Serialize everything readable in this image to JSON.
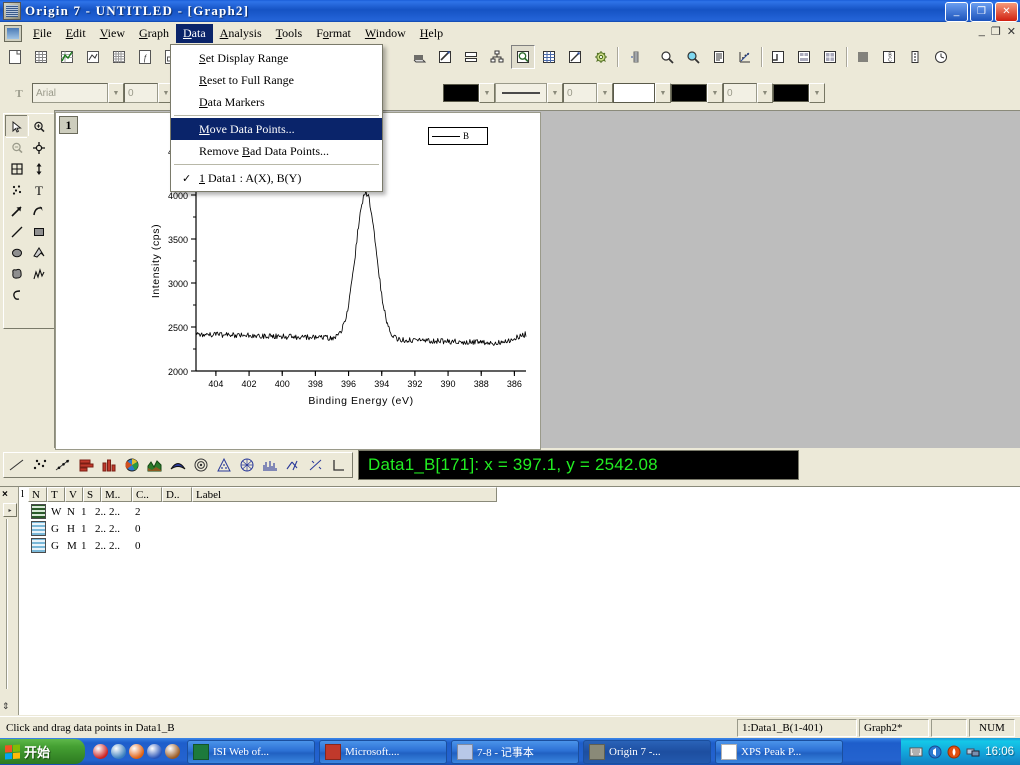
{
  "window": {
    "title": "Origin 7 - UNTITLED - [Graph2]",
    "minimize_label": "_",
    "maximize_label": "❐",
    "close_label": "✕",
    "mdi_minimize": "_",
    "mdi_restore": "❐",
    "mdi_close": "✕"
  },
  "menubar": {
    "items": [
      {
        "label": "File",
        "mnemonic": "F"
      },
      {
        "label": "Edit",
        "mnemonic": "E"
      },
      {
        "label": "View",
        "mnemonic": "V"
      },
      {
        "label": "Graph",
        "mnemonic": "G"
      },
      {
        "label": "Data",
        "mnemonic": "D"
      },
      {
        "label": "Analysis",
        "mnemonic": "A"
      },
      {
        "label": "Tools",
        "mnemonic": "T"
      },
      {
        "label": "Format",
        "mnemonic": "o"
      },
      {
        "label": "Window",
        "mnemonic": "W"
      },
      {
        "label": "Help",
        "mnemonic": "H"
      }
    ],
    "active_index": 4
  },
  "data_menu": {
    "items": [
      {
        "label": "Set Display Range",
        "mnemonic": "S",
        "selected": false,
        "checked": false
      },
      {
        "label": "Reset to Full Range",
        "mnemonic": "R",
        "selected": false,
        "checked": false
      },
      {
        "label": "Data Markers",
        "mnemonic": "D",
        "selected": false,
        "checked": false
      },
      {
        "separator": true
      },
      {
        "label": "Move Data Points...",
        "mnemonic": "M",
        "selected": true,
        "checked": false
      },
      {
        "label": "Remove Bad Data Points...",
        "mnemonic": "B",
        "selected": false,
        "checked": false
      },
      {
        "separator": true
      },
      {
        "label": "1     Data1 : A(X), B(Y)",
        "mnemonic": "1",
        "selected": false,
        "checked": true
      }
    ]
  },
  "standard_toolbar": {
    "buttons": [
      {
        "name": "new-project-icon",
        "glyph": "page"
      },
      {
        "name": "new-worksheet-icon",
        "glyph": "grid"
      },
      {
        "name": "new-graph-icon",
        "glyph": "gridgraph"
      },
      {
        "name": "new-layout-icon",
        "glyph": "layout"
      },
      {
        "name": "new-matrix-icon",
        "glyph": "matrix"
      },
      {
        "name": "new-function-icon",
        "glyph": "fx"
      },
      {
        "name": "new-notes-icon",
        "glyph": "notes"
      },
      {
        "name": "print-stack-icon",
        "glyph": "stack"
      },
      {
        "name": "edit-icon",
        "glyph": "pen"
      },
      {
        "name": "layer-icon",
        "glyph": "layers"
      },
      {
        "name": "project-explorer-icon",
        "glyph": "tree"
      },
      {
        "name": "zoom-panel-icon",
        "glyph": "magnifier",
        "pressed": true
      },
      {
        "name": "worksheet-icon",
        "glyph": "sheet"
      },
      {
        "name": "export-icon",
        "glyph": "export"
      },
      {
        "name": "options-icon",
        "glyph": "gear"
      },
      {
        "name": "scale-icon",
        "glyph": "scale"
      },
      {
        "name": "zoom-in-icon",
        "glyph": "zoomin"
      },
      {
        "name": "zoom-out-icon",
        "glyph": "zoomout"
      },
      {
        "name": "text-tool-icon",
        "glyph": "textdoc"
      },
      {
        "name": "mask-icon",
        "glyph": "mask"
      },
      {
        "name": "rescale-icon",
        "glyph": "rescale"
      },
      {
        "name": "arrange-layers-icon",
        "glyph": "arrange"
      },
      {
        "name": "add-layer-icon",
        "glyph": "addlayer"
      },
      {
        "name": "lines-icon",
        "glyph": "lines"
      },
      {
        "name": "label-icon",
        "glyph": "label"
      },
      {
        "name": "column-icon",
        "glyph": "col"
      },
      {
        "name": "timer-icon",
        "glyph": "clock"
      }
    ]
  },
  "format_toolbar": {
    "font_name": "Arial",
    "font_size": "0",
    "bold_label": "B",
    "line_width": "0",
    "fill_value": "0",
    "colors": {
      "text_color": "#000000",
      "line_color": "#000000",
      "fill_color": "#ffffff",
      "pattern_color": "#000000"
    }
  },
  "tools_palette": {
    "buttons": [
      {
        "name": "pointer-tool",
        "glyph": "arrow",
        "pressed": true
      },
      {
        "name": "zoom-in-tool",
        "glyph": "zoomplus"
      },
      {
        "name": "zoom-out-tool",
        "glyph": "zoomminus",
        "disabled": true
      },
      {
        "name": "screen-reader-tool",
        "glyph": "crosshair"
      },
      {
        "name": "data-selector-tool",
        "glyph": "selectbox"
      },
      {
        "name": "data-reader-tool",
        "glyph": "updown"
      },
      {
        "name": "data-display-tool",
        "glyph": "dots"
      },
      {
        "name": "text-tool",
        "glyph": "T"
      },
      {
        "name": "arrow-tool",
        "glyph": "arrowline"
      },
      {
        "name": "curved-arrow-tool",
        "glyph": "curvearrow"
      },
      {
        "name": "line-tool",
        "glyph": "line"
      },
      {
        "name": "rectangle-tool",
        "glyph": "rect"
      },
      {
        "name": "ellipse-tool",
        "glyph": "ellipse"
      },
      {
        "name": "polygon-tool",
        "glyph": "polygon"
      },
      {
        "name": "region-tool",
        "glyph": "blob"
      },
      {
        "name": "freehand-tool",
        "glyph": "freehand"
      },
      {
        "name": "undo-tool",
        "glyph": "undo"
      }
    ]
  },
  "plot_toolbar": {
    "buttons": [
      {
        "name": "line-plot-icon",
        "glyph": "line"
      },
      {
        "name": "scatter-plot-icon",
        "glyph": "scatter"
      },
      {
        "name": "line-symbol-plot-icon",
        "glyph": "linesym"
      },
      {
        "name": "bar-plot-icon",
        "glyph": "bar"
      },
      {
        "name": "column-plot-icon",
        "glyph": "column"
      },
      {
        "name": "pie-plot-icon",
        "glyph": "pie"
      },
      {
        "name": "area-plot-icon",
        "glyph": "area"
      },
      {
        "name": "fill-area-plot-icon",
        "glyph": "fillarea"
      },
      {
        "name": "polar-plot-icon",
        "glyph": "polar"
      },
      {
        "name": "ternary-plot-icon",
        "glyph": "ternary"
      },
      {
        "name": "contour-plot-icon",
        "glyph": "contour"
      },
      {
        "name": "waterfall-plot-icon",
        "glyph": "waterfall"
      },
      {
        "name": "vector-plot-icon",
        "glyph": "vector"
      },
      {
        "name": "zoom-plot-icon",
        "glyph": "zoomplot"
      },
      {
        "name": "double-axis-icon",
        "glyph": "doubleaxis"
      }
    ]
  },
  "graph_window": {
    "layer_badge": "1",
    "legend_label": "B"
  },
  "readout": {
    "text": "Data1_B[171]: x = 397.1, y = 2542.08",
    "dataset": "Data1_B",
    "index": "171",
    "x": "397.1",
    "y": "2542.08",
    "fg_color": "#22ee22",
    "bg_color": "#000000"
  },
  "project_explorer": {
    "columns": [
      "N",
      "T",
      "V",
      "S",
      "M..",
      "C..",
      "D..",
      "Label"
    ],
    "close_label": "×",
    "tab_label": "l",
    "scroll_label": "▸",
    "rows": [
      {
        "icon": "worksheet-icon",
        "cells": [
          "W",
          "N",
          "1",
          "2..",
          "2..",
          "2",
          ""
        ]
      },
      {
        "icon": "graph-icon",
        "cells": [
          "G",
          "H",
          "1",
          "2..",
          "2..",
          "0",
          ""
        ]
      },
      {
        "icon": "graph-icon",
        "cells": [
          "G",
          "M",
          "1",
          "2..",
          "2..",
          "0",
          ""
        ]
      }
    ]
  },
  "statusbar": {
    "message": "Click and drag data points in Data1_B",
    "dataset": "1:Data1_B(1-401)",
    "window": "Graph2*",
    "empty": "",
    "num_lock": "NUM"
  },
  "taskbar": {
    "start_label": "开始",
    "quick_launch": [
      {
        "name": "quicklaunch-opera-icon",
        "color": "#cc2222"
      },
      {
        "name": "quicklaunch-maxthon-icon",
        "color": "#3a7fbf"
      },
      {
        "name": "quicklaunch-firefox-icon",
        "color": "#e06010"
      },
      {
        "name": "quicklaunch-media-icon",
        "color": "#2a55b8"
      },
      {
        "name": "quicklaunch-browser-icon",
        "color": "#9a5a22"
      }
    ],
    "tasks": [
      {
        "label": "ISI Web of...",
        "icon_color": "#1d7a3c",
        "active": false
      },
      {
        "label": "Microsoft....",
        "icon_color": "#c0392b",
        "active": false
      },
      {
        "label": "7-8 - 记事本",
        "icon_color": "#b8c8e8",
        "active": false
      },
      {
        "label": "Origin 7 -...",
        "icon_color": "#8a8a78",
        "active": true
      },
      {
        "label": "XPS Peak P...",
        "icon_color": "#ffffff",
        "active": false
      }
    ],
    "tray_icons": [
      {
        "name": "tray-keyboard-icon",
        "color": "#dcdcdc"
      },
      {
        "name": "tray-volume-icon",
        "color": "#8fd8f5"
      },
      {
        "name": "tray-antivirus-icon",
        "color": "#e05010"
      },
      {
        "name": "tray-network-icon",
        "color": "#4a7ab5"
      }
    ],
    "clock": "16:06"
  },
  "chart_data": {
    "type": "line",
    "title": "",
    "xlabel": "Binding Energy (eV)",
    "ylabel": "Intensity (cps)",
    "xticks": [
      404,
      402,
      400,
      398,
      396,
      394,
      392,
      390,
      388,
      386
    ],
    "yticks": [
      2000,
      2500,
      3000,
      3500,
      4000,
      4500
    ],
    "xlim": [
      405.2,
      385.3
    ],
    "ylim": [
      2000,
      4500
    ],
    "x_reversed": true,
    "grid": false,
    "legend_position": "top-right",
    "series": [
      {
        "name": "B",
        "color": "#000000",
        "baseline_left": 2420,
        "baseline_right": 2310,
        "peak_center": 394.95,
        "peak_height": 4090,
        "peak_fwhm": 1.45,
        "noise_amplitude": 62,
        "n_points": 401,
        "description": "XPS N 1s core-level spectrum: flat noisy background near 2300-2450 cps with a single sharp peak reaching about 4090 cps at roughly 395 eV binding energy."
      }
    ],
    "highlighted_point": {
      "index": 171,
      "x": 397.1,
      "y": 2542.08
    }
  }
}
